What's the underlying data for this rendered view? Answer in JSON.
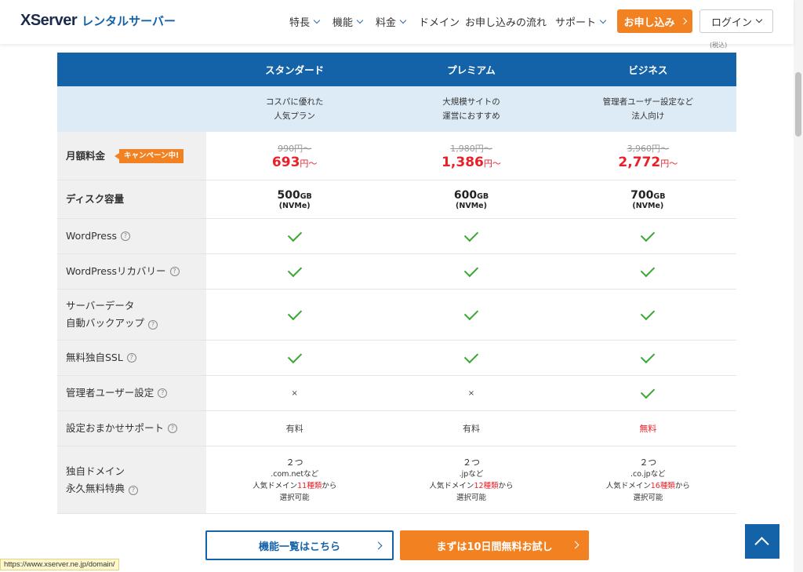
{
  "header": {
    "logo_main": "XServer",
    "logo_sub": "レンタルサーバー",
    "nav": [
      {
        "label": "特長"
      },
      {
        "label": "機能"
      },
      {
        "label": "料金"
      },
      {
        "label": "ドメイン"
      },
      {
        "label": "お申し込みの流れ"
      },
      {
        "label": "サポート"
      }
    ],
    "apply_label": "お申し込み",
    "login_label": "ログイン",
    "tiny_note": "(税込)"
  },
  "plans": [
    {
      "name": "スタンダード",
      "desc1": "コスパに優れた",
      "desc2": "人気プラン",
      "old_price": "990円〜",
      "price": "693",
      "price_unit": "円〜",
      "disk": "500",
      "disk_unit": "GB",
      "disk_type": "(NVMe)",
      "admin_user": "×",
      "support": "有料",
      "dom_count": "２つ",
      "dom_tld": ".com.netなど",
      "dom_pre": "人気ドメイン",
      "dom_kinds": "11種類",
      "dom_post": "から",
      "dom_select": "選択可能"
    },
    {
      "name": "プレミアム",
      "desc1": "大規模サイトの",
      "desc2": "運営におすすめ",
      "old_price": "1,980円〜",
      "price": "1,386",
      "price_unit": "円〜",
      "disk": "600",
      "disk_unit": "GB",
      "disk_type": "(NVMe)",
      "admin_user": "×",
      "support": "有料",
      "dom_count": "２つ",
      "dom_tld": ".jpなど",
      "dom_pre": "人気ドメイン",
      "dom_kinds": "12種類",
      "dom_post": "から",
      "dom_select": "選択可能"
    },
    {
      "name": "ビジネス",
      "desc1": "管理者ユーザー設定など",
      "desc2": "法人向け",
      "old_price": "3,960円〜",
      "price": "2,772",
      "price_unit": "円〜",
      "disk": "700",
      "disk_unit": "GB",
      "disk_type": "(NVMe)",
      "admin_user": "",
      "support": "無料",
      "dom_count": "２つ",
      "dom_tld": ".co.jpなど",
      "dom_pre": "人気ドメイン",
      "dom_kinds": "16種類",
      "dom_post": "から",
      "dom_select": "選択可能"
    }
  ],
  "rows": {
    "price": "月額料金",
    "campaign": "キャンペーン中!",
    "disk": "ディスク容量",
    "wordpress": "WordPress",
    "wp_recovery": "WordPressリカバリー",
    "backup_1": "サーバーデータ",
    "backup_2": "自動バックアップ",
    "ssl": "無料独自SSL",
    "admin_user": "管理者ユーザー設定",
    "support": "設定おまかせサポート",
    "domain_1": "独自ドメイン",
    "domain_2": "永久無料特典"
  },
  "buttons": {
    "features": "機能一覧はこちら",
    "trial": "まずは10日間無料お試し"
  },
  "help_icon": "?",
  "status_url": "https://www.xserver.ne.jp/domain/",
  "colors": {
    "brand": "#1463a8",
    "accent": "#f28121",
    "price_red": "#e8202a",
    "check_green": "#3aa835"
  }
}
